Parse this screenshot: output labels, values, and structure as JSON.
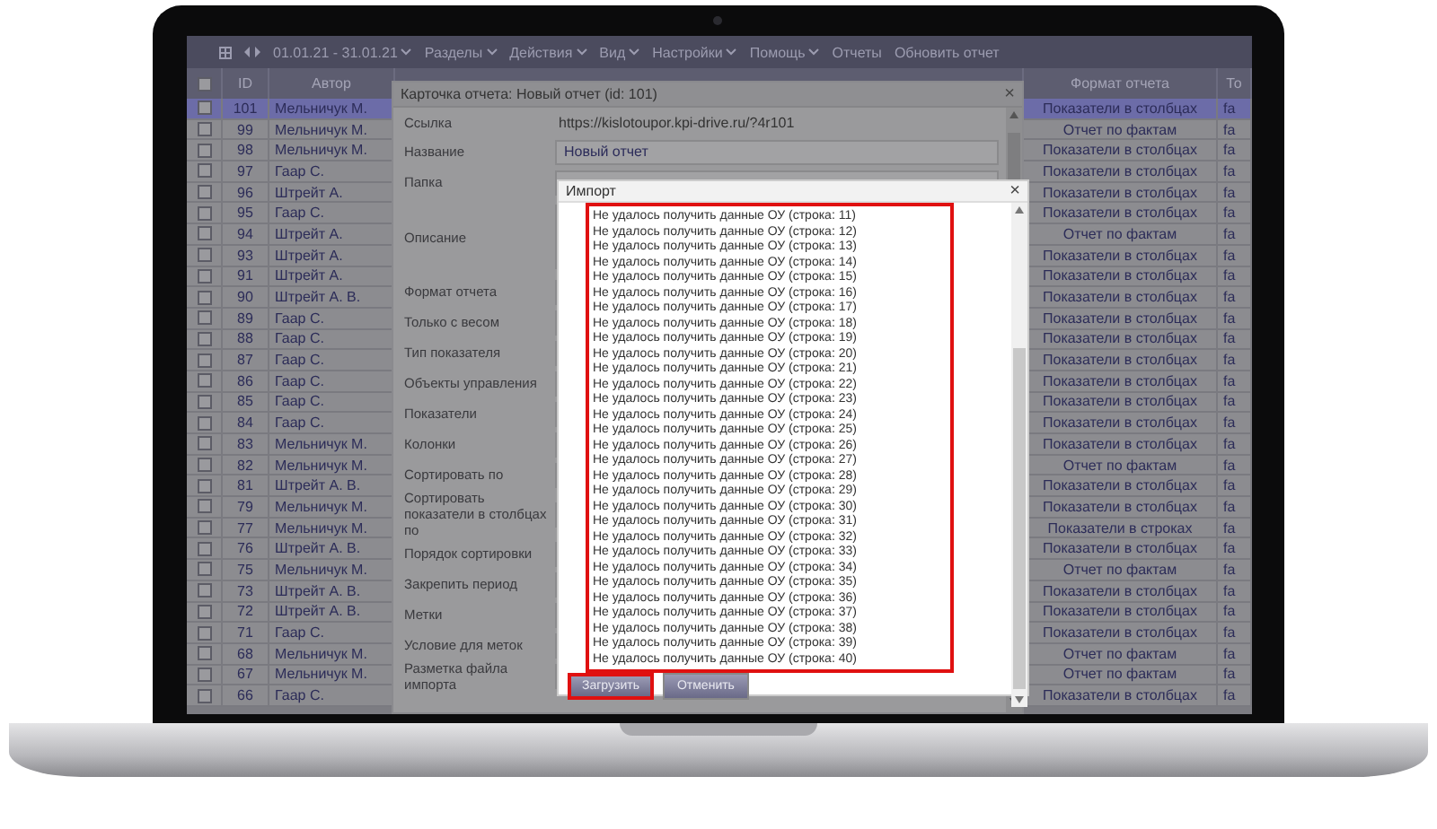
{
  "toolbar": {
    "date_range": "01.01.21 - 31.01.21",
    "menus": [
      {
        "label": "Разделы",
        "dropdown": true
      },
      {
        "label": "Действия",
        "dropdown": true
      },
      {
        "label": "Вид",
        "dropdown": true
      },
      {
        "label": "Настройки",
        "dropdown": true
      },
      {
        "label": "Помощь",
        "dropdown": true
      },
      {
        "label": "Отчеты",
        "dropdown": false
      },
      {
        "label": "Обновить отчет",
        "dropdown": false
      }
    ]
  },
  "table": {
    "select_all_checked": false,
    "columns": [
      "ID",
      "Автор",
      "Формат отчета",
      "То"
    ],
    "rows": [
      {
        "id": "101",
        "author": "Мельничук М.",
        "format": "Показатели в столбцах",
        "column_5": "fa",
        "selected": true,
        "checked": false
      },
      {
        "id": "99",
        "author": "Мельничук М.",
        "format": "Отчет по фактам",
        "column_5": "fa",
        "selected": false,
        "checked": false
      },
      {
        "id": "98",
        "author": "Мельничук М.",
        "format": "Показатели в столбцах",
        "column_5": "fa",
        "selected": false,
        "checked": false
      },
      {
        "id": "97",
        "author": "Гаар С.",
        "format": "Показатели в столбцах",
        "column_5": "fa",
        "selected": false,
        "checked": false
      },
      {
        "id": "96",
        "author": "Штрейт А.",
        "format": "Показатели в столбцах",
        "column_5": "fa",
        "selected": false,
        "checked": false
      },
      {
        "id": "95",
        "author": "Гаар С.",
        "format": "Показатели в столбцах",
        "column_5": "fa",
        "selected": false,
        "checked": false
      },
      {
        "id": "94",
        "author": "Штрейт А.",
        "format": "Отчет по фактам",
        "column_5": "fa",
        "selected": false,
        "checked": false
      },
      {
        "id": "93",
        "author": "Штрейт А.",
        "format": "Показатели в столбцах",
        "column_5": "fa",
        "selected": false,
        "checked": false
      },
      {
        "id": "91",
        "author": "Штрейт А.",
        "format": "Показатели в столбцах",
        "column_5": "fa",
        "selected": false,
        "checked": false
      },
      {
        "id": "90",
        "author": "Штрейт А. В.",
        "format": "Показатели в столбцах",
        "column_5": "fa",
        "selected": false,
        "checked": false
      },
      {
        "id": "89",
        "author": "Гаар С.",
        "format": "Показатели в столбцах",
        "column_5": "fa",
        "selected": false,
        "checked": false
      },
      {
        "id": "88",
        "author": "Гаар С.",
        "format": "Показатели в столбцах",
        "column_5": "fa",
        "selected": false,
        "checked": false
      },
      {
        "id": "87",
        "author": "Гаар С.",
        "format": "Показатели в столбцах",
        "column_5": "fa",
        "selected": false,
        "checked": false
      },
      {
        "id": "86",
        "author": "Гаар С.",
        "format": "Показатели в столбцах",
        "column_5": "fa",
        "selected": false,
        "checked": false
      },
      {
        "id": "85",
        "author": "Гаар С.",
        "format": "Показатели в столбцах",
        "column_5": "fa",
        "selected": false,
        "checked": false
      },
      {
        "id": "84",
        "author": "Гаар С.",
        "format": "Показатели в столбцах",
        "column_5": "fa",
        "selected": false,
        "checked": false
      },
      {
        "id": "83",
        "author": "Мельничук М.",
        "format": "Показатели в столбцах",
        "column_5": "fa",
        "selected": false,
        "checked": false
      },
      {
        "id": "82",
        "author": "Мельничук М.",
        "format": "Отчет по фактам",
        "column_5": "fa",
        "selected": false,
        "checked": false
      },
      {
        "id": "81",
        "author": "Штрейт А. В.",
        "format": "Показатели в столбцах",
        "column_5": "fa",
        "selected": false,
        "checked": false
      },
      {
        "id": "79",
        "author": "Мельничук М.",
        "format": "Показатели в столбцах",
        "column_5": "fa",
        "selected": false,
        "checked": false
      },
      {
        "id": "77",
        "author": "Мельничук М.",
        "format": "Показатели в строках",
        "column_5": "fa",
        "selected": false,
        "checked": false
      },
      {
        "id": "76",
        "author": "Штрейт А. В.",
        "format": "Показатели в столбцах",
        "column_5": "fa",
        "selected": false,
        "checked": false
      },
      {
        "id": "75",
        "author": "Мельничук М.",
        "format": "Отчет по фактам",
        "column_5": "fa",
        "selected": false,
        "checked": false
      },
      {
        "id": "73",
        "author": "Штрейт А. В.",
        "format": "Показатели в столбцах",
        "column_5": "fa",
        "selected": false,
        "checked": false
      },
      {
        "id": "72",
        "author": "Штрейт А. В.",
        "format": "Показатели в столбцах",
        "column_5": "fa",
        "selected": false,
        "checked": false
      },
      {
        "id": "71",
        "author": "Гаар С.",
        "format": "Показатели в столбцах",
        "column_5": "fa",
        "selected": false,
        "checked": false
      },
      {
        "id": "68",
        "author": "Мельничук М.",
        "format": "Отчет по фактам",
        "column_5": "fa",
        "selected": false,
        "checked": false
      },
      {
        "id": "67",
        "author": "Мельничук М.",
        "format": "Отчет по фактам",
        "column_5": "fa",
        "selected": false,
        "checked": false
      },
      {
        "id": "66",
        "author": "Гаар С.",
        "format": "Показатели в столбцах",
        "column_5": "fa",
        "selected": false,
        "checked": false
      }
    ]
  },
  "report_card": {
    "title": "Карточка отчета: Новый отчет (id: 101)",
    "close": "×",
    "fields": [
      {
        "label": "Ссылка",
        "kind": "link",
        "value": "https://kislotoupor.kpi-drive.ru/?4r101"
      },
      {
        "label": "Название",
        "kind": "input",
        "value": "Новый отчет"
      },
      {
        "label": "Папка",
        "kind": "input"
      },
      {
        "label": "Описание",
        "kind": "textarea"
      },
      {
        "label": "Формат отчета",
        "kind": "input"
      },
      {
        "label": "Только с весом",
        "kind": "input"
      },
      {
        "label": "Тип показателя",
        "kind": "input"
      },
      {
        "label": "Объекты управления",
        "kind": "input"
      },
      {
        "label": "Показатели",
        "kind": "input"
      },
      {
        "label": "Колонки",
        "kind": "input"
      },
      {
        "label": "Сортировать по",
        "kind": "input"
      },
      {
        "label": "Сортировать показатели в столбцах по",
        "kind": "input"
      },
      {
        "label": "Порядок сортировки",
        "kind": "input"
      },
      {
        "label": "Закрепить период",
        "kind": "input"
      },
      {
        "label": "Метки",
        "kind": "input"
      },
      {
        "label": "Условие для меток",
        "kind": "input"
      },
      {
        "label": "Разметка файла импорта",
        "kind": "input"
      }
    ]
  },
  "import_dialog": {
    "title": "Импорт",
    "close": "×",
    "log_highlighted": true,
    "log": [
      "Не удалось получить данные ОУ (строка: 11)",
      "Не удалось получить данные ОУ (строка: 12)",
      "Не удалось получить данные ОУ (строка: 13)",
      "Не удалось получить данные ОУ (строка: 14)",
      "Не удалось получить данные ОУ (строка: 15)",
      "Не удалось получить данные ОУ (строка: 16)",
      "Не удалось получить данные ОУ (строка: 17)",
      "Не удалось получить данные ОУ (строка: 18)",
      "Не удалось получить данные ОУ (строка: 19)",
      "Не удалось получить данные ОУ (строка: 20)",
      "Не удалось получить данные ОУ (строка: 21)",
      "Не удалось получить данные ОУ (строка: 22)",
      "Не удалось получить данные ОУ (строка: 23)",
      "Не удалось получить данные ОУ (строка: 24)",
      "Не удалось получить данные ОУ (строка: 25)",
      "Не удалось получить данные ОУ (строка: 26)",
      "Не удалось получить данные ОУ (строка: 27)",
      "Не удалось получить данные ОУ (строка: 28)",
      "Не удалось получить данные ОУ (строка: 29)",
      "Не удалось получить данные ОУ (строка: 30)",
      "Не удалось получить данные ОУ (строка: 31)",
      "Не удалось получить данные ОУ (строка: 32)",
      "Не удалось получить данные ОУ (строка: 33)",
      "Не удалось получить данные ОУ (строка: 34)",
      "Не удалось получить данные ОУ (строка: 35)",
      "Не удалось получить данные ОУ (строка: 36)",
      "Не удалось получить данные ОУ (строка: 37)",
      "Не удалось получить данные ОУ (строка: 38)",
      "Не удалось получить данные ОУ (строка: 39)",
      "Не удалось получить данные ОУ (строка: 40)"
    ],
    "buttons": [
      {
        "label": "Загрузить",
        "highlighted": true
      },
      {
        "label": "Отменить",
        "highlighted": false
      }
    ]
  }
}
